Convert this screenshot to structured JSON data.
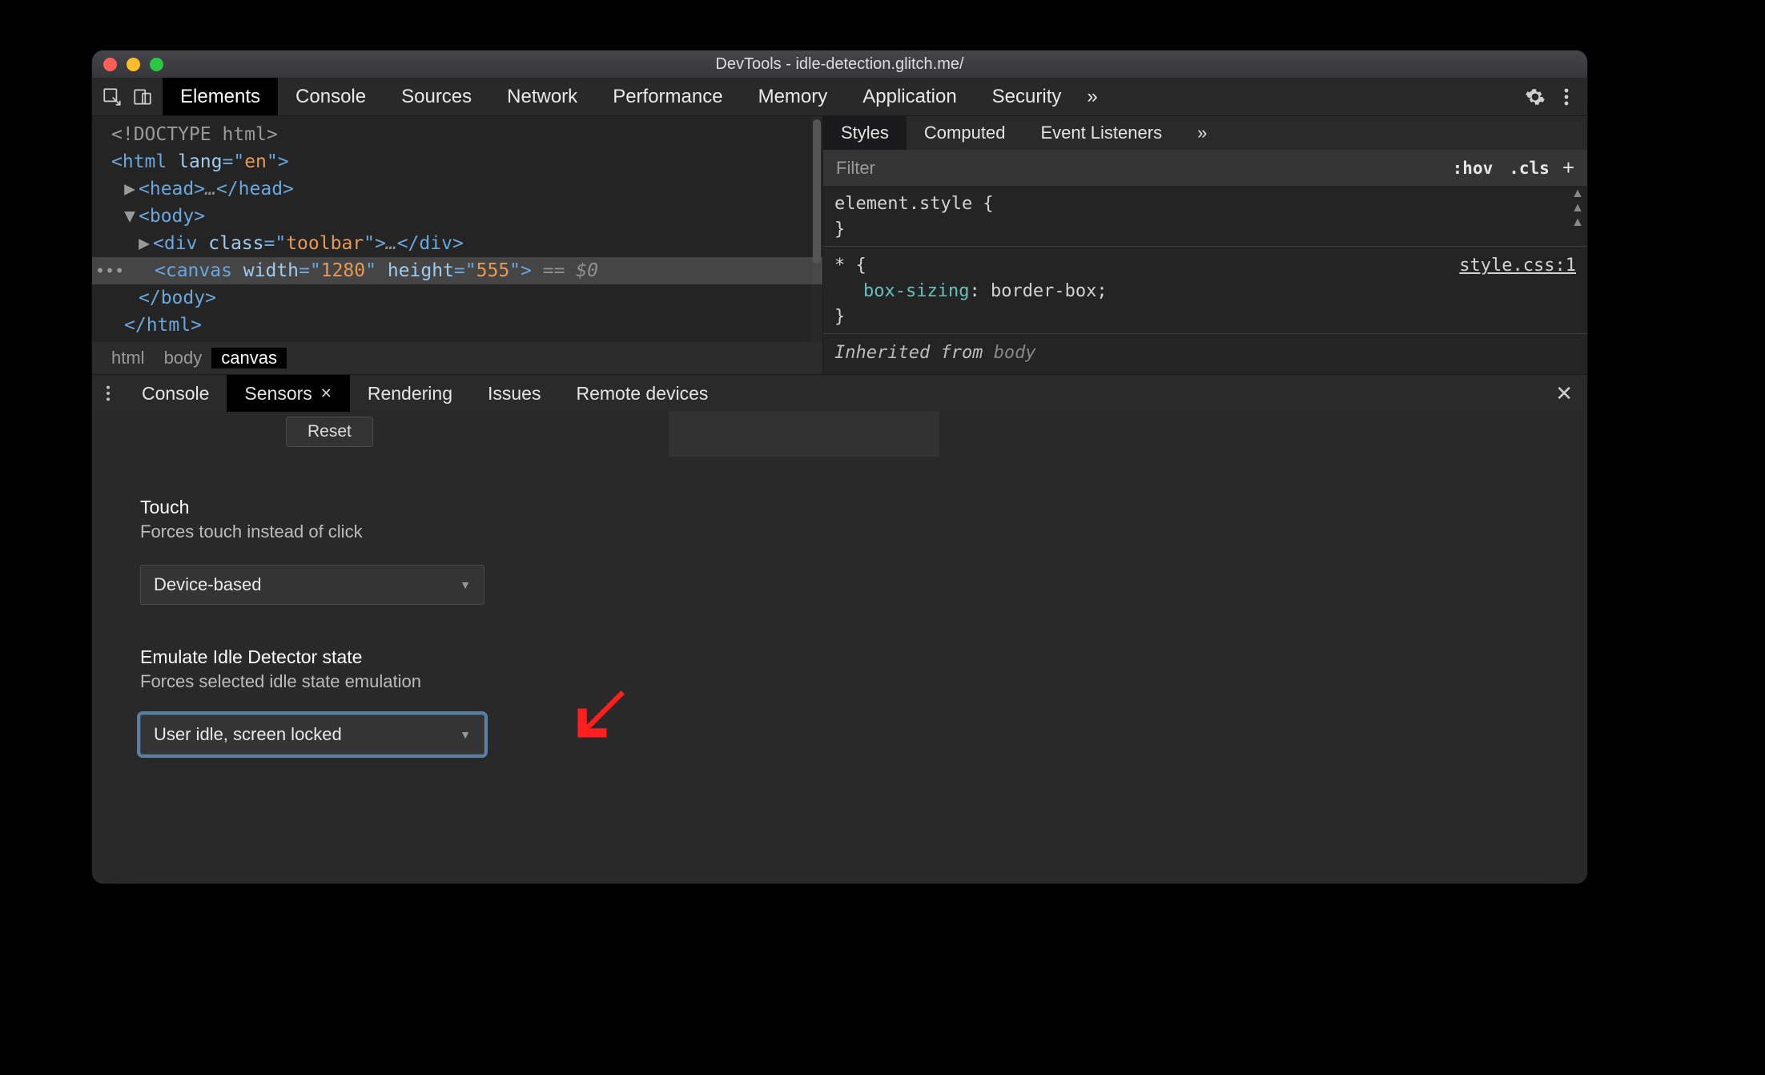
{
  "window": {
    "title": "DevTools - idle-detection.glitch.me/"
  },
  "toolbar": {
    "tabs": [
      "Elements",
      "Console",
      "Sources",
      "Network",
      "Performance",
      "Memory",
      "Application",
      "Security"
    ],
    "active_index": 0,
    "overflow_glyph": "»"
  },
  "elements_panel": {
    "dom_lines": [
      {
        "indent": 0,
        "selected": false,
        "tokens": [
          {
            "t": "<!DOCTYPE html>",
            "c": "p-doctype"
          }
        ]
      },
      {
        "indent": 0,
        "selected": false,
        "tokens": [
          {
            "t": "<",
            "c": "p-tag"
          },
          {
            "t": "html ",
            "c": "p-tag"
          },
          {
            "t": "lang",
            "c": "p-attr"
          },
          {
            "t": "=\"",
            "c": "p-tag"
          },
          {
            "t": "en",
            "c": "p-str"
          },
          {
            "t": "\">",
            "c": "p-tag"
          }
        ]
      },
      {
        "indent": 1,
        "selected": false,
        "tri": "▶",
        "tokens": [
          {
            "t": "<head>",
            "c": "p-tag"
          },
          {
            "t": "…",
            "c": "p-ghost"
          },
          {
            "t": "</head>",
            "c": "p-tag"
          }
        ]
      },
      {
        "indent": 1,
        "selected": false,
        "tri": "▼",
        "tokens": [
          {
            "t": "<body>",
            "c": "p-tag"
          }
        ]
      },
      {
        "indent": 2,
        "selected": false,
        "tri": "▶",
        "tokens": [
          {
            "t": "<div ",
            "c": "p-tag"
          },
          {
            "t": "class",
            "c": "p-attr"
          },
          {
            "t": "=\"",
            "c": "p-tag"
          },
          {
            "t": "toolbar",
            "c": "p-str"
          },
          {
            "t": "\">",
            "c": "p-tag"
          },
          {
            "t": "…",
            "c": "p-ghost"
          },
          {
            "t": "</div>",
            "c": "p-tag"
          }
        ]
      },
      {
        "indent": 3,
        "selected": true,
        "dots": true,
        "tokens": [
          {
            "t": "<canvas ",
            "c": "p-tag"
          },
          {
            "t": "width",
            "c": "p-attr"
          },
          {
            "t": "=\"",
            "c": "p-tag"
          },
          {
            "t": "1280",
            "c": "p-str"
          },
          {
            "t": "\" ",
            "c": "p-tag"
          },
          {
            "t": "height",
            "c": "p-attr"
          },
          {
            "t": "=\"",
            "c": "p-tag"
          },
          {
            "t": "555",
            "c": "p-str"
          },
          {
            "t": "\">",
            "c": "p-tag"
          },
          {
            "t": " == ",
            "c": "p-ghost"
          },
          {
            "t": "$0",
            "c": "p-ghost"
          }
        ]
      },
      {
        "indent": 2,
        "selected": false,
        "tokens": [
          {
            "t": "</body>",
            "c": "p-tag"
          }
        ]
      },
      {
        "indent": 1,
        "selected": false,
        "tokens": [
          {
            "t": "</html>",
            "c": "p-tag"
          }
        ]
      }
    ],
    "breadcrumb": [
      "html",
      "body",
      "canvas"
    ],
    "breadcrumb_active_index": 2
  },
  "styles_panel": {
    "tabs": [
      "Styles",
      "Computed",
      "Event Listeners"
    ],
    "active_index": 0,
    "overflow_glyph": "»",
    "filter_placeholder": "Filter",
    "hov": ":hov",
    "cls": ".cls",
    "plus": "+",
    "rule1_header": "element.style {",
    "rule1_close": "}",
    "rule2_selector": "* {",
    "rule2_source": "style.css:1",
    "rule2_prop": "box-sizing",
    "rule2_val": "border-box",
    "rule2_close": "}",
    "inherited_label": "Inherited from ",
    "inherited_from": "body"
  },
  "drawer": {
    "tabs": [
      "Console",
      "Sensors",
      "Rendering",
      "Issues",
      "Remote devices"
    ],
    "active_index": 1,
    "reset_label": "Reset",
    "section_touch": {
      "title": "Touch",
      "desc": "Forces touch instead of click",
      "dropdown_value": "Device-based"
    },
    "section_idle": {
      "title": "Emulate Idle Detector state",
      "desc": "Forces selected idle state emulation",
      "dropdown_value": "User idle, screen locked"
    }
  }
}
